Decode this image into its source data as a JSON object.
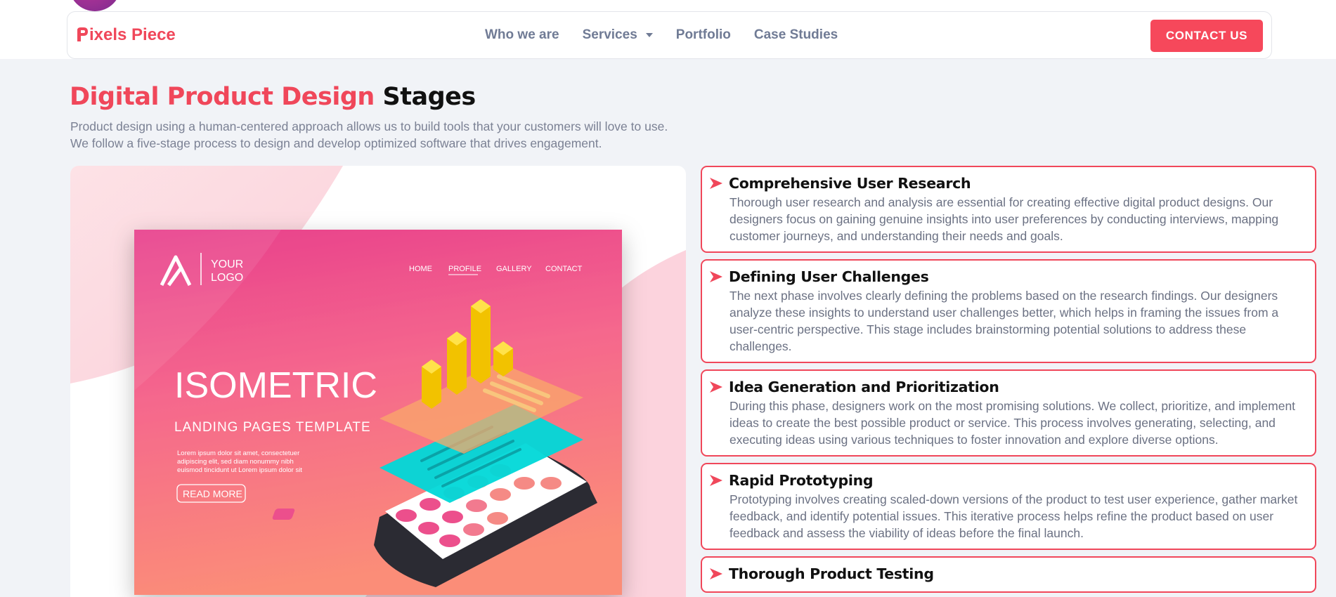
{
  "brand": {
    "logo_text": "ixels Piece",
    "logo_initial_icon": "p-logo-mark",
    "color": "#f0475a"
  },
  "nav": {
    "items": [
      {
        "label": "Who we are",
        "has_dropdown": false
      },
      {
        "label": "Services",
        "has_dropdown": true
      },
      {
        "label": "Portfolio",
        "has_dropdown": false
      },
      {
        "label": "Case Studies",
        "has_dropdown": false
      }
    ],
    "contact_label": "CONTACT US"
  },
  "page": {
    "title_accent": "Digital Product Design",
    "title_rest": " Stages",
    "intro_line1": "Product design using a human-centered approach allows us to build tools that your customers will love to use.",
    "intro_line2": "We follow a five-stage process to design and develop optimized software that drives engagement."
  },
  "illustration": {
    "logo_line1": "YOUR",
    "logo_line2": "LOGO",
    "menu": [
      "HOME",
      "PROFILE",
      "GALLERY",
      "CONTACT"
    ],
    "active_menu": "PROFILE",
    "headline": "ISOMETRIC",
    "subheadline": "LANDING PAGES TEMPLATE",
    "body_line1": "Lorem ipsum dolor sit amet, consectetuer",
    "body_line2": "adipiscing elit, sed diam nonummy nibh",
    "body_line3": "euismod tincidunt ut Lorem ipsum dolor sit",
    "button": "READ MORE"
  },
  "stages": [
    {
      "title": "Comprehensive User Research",
      "desc": "Thorough user research and analysis are essential for creating effective digital product designs. Our designers focus on gaining genuine insights into user preferences by conducting interviews, mapping customer journeys, and understanding their needs and goals."
    },
    {
      "title": "Defining User Challenges",
      "desc": "The next phase involves clearly defining the problems based on the research findings. Our designers analyze these insights to understand user challenges better, which helps in framing the issues from a user-centric perspective. This stage includes brainstorming potential solutions to address these challenges."
    },
    {
      "title": "Idea Generation and Prioritization",
      "desc": "During this phase, designers work on the most promising solutions. We collect, prioritize, and implement ideas to create the best possible product or service. This process involves generating, selecting, and executing ideas using various techniques to foster innovation and explore diverse options."
    },
    {
      "title": "Rapid Prototyping",
      "desc": "Prototyping involves creating scaled-down versions of the product to test user experience, gather market feedback, and identify potential issues. This iterative process helps refine the product based on user feedback and assess the viability of ideas before the final launch."
    },
    {
      "title": "Thorough Product Testing",
      "desc": ""
    }
  ],
  "colors": {
    "accent": "#f0475a",
    "button": "#f6485b",
    "muted_text": "#6b7183",
    "page_bg": "#f1f3f7"
  }
}
